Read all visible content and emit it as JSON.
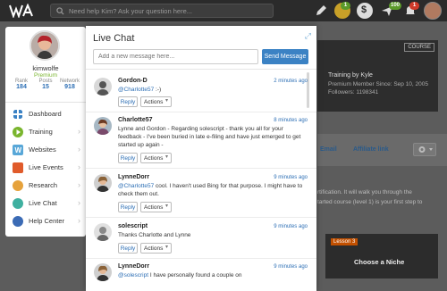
{
  "topbar": {
    "search_placeholder": "Need help Kim? Ask your question here...",
    "badges": {
      "coins": "1",
      "messages": "100",
      "notifications": "1"
    }
  },
  "background": {
    "course_button": "COURSE",
    "trainer": "Training by Kyle",
    "member_since": "Premium Member Since: Sep 10, 2005",
    "followers": "Followers: 1198341",
    "share_label": "Email",
    "affiliate_label": "Affiliate link",
    "body_text_1": "rtification. It will walk you through the",
    "body_text_2": "tarted course (level 1) is your first step to",
    "lesson_label": "Lesson 3",
    "niche_title": "Choose a Niche"
  },
  "user": {
    "name": "kimwolfe",
    "role": "Premium",
    "stats": [
      {
        "label": "Rank",
        "value": "184"
      },
      {
        "label": "Posts",
        "value": "15"
      },
      {
        "label": "Network",
        "value": "918"
      }
    ]
  },
  "nav": {
    "items": [
      {
        "label": "Dashboard",
        "color": "#3b82c4"
      },
      {
        "label": "Training",
        "color": "#7ab52e"
      },
      {
        "label": "Websites",
        "color": "#58a7d8"
      },
      {
        "label": "Live Events",
        "color": "#e05b2b"
      },
      {
        "label": "Research",
        "color": "#e6a23c"
      },
      {
        "label": "Live Chat",
        "color": "#3fb0a0"
      },
      {
        "label": "Help Center",
        "color": "#3b6bb5"
      }
    ]
  },
  "chat": {
    "title": "Live Chat",
    "input_placeholder": "Add a new message here...",
    "send_label": "Send Message",
    "reply_label": "Reply",
    "actions_label": "Actions",
    "messages": [
      {
        "name": "Gordon-D",
        "time": "2 minutes ago",
        "mention": "@Charlotte57",
        "text": " :-)"
      },
      {
        "name": "Charlotte57",
        "time": "8 minutes ago",
        "mention": "",
        "text": "Lynne and Gordon - Regarding solescript - thank you all for your feedback - I've been buried in late e-filing and have just emerged to get started up again -"
      },
      {
        "name": "LynneDorr",
        "time": "9 minutes ago",
        "mention": "@Charlotte57",
        "text": " cool. I haven't used Bing for that purpose. I might have to check them out."
      },
      {
        "name": "solescript",
        "time": "9 minutes ago",
        "mention": "",
        "text": "Thanks Charlotte and Lynne"
      },
      {
        "name": "LynneDorr",
        "time": "9 minutes ago",
        "mention": "@solescript",
        "text": " I have personally found a couple on"
      }
    ]
  },
  "colors": {
    "accent": "#3b82c4",
    "premium": "#7ab52e",
    "topbar": "#2b2b2b"
  }
}
